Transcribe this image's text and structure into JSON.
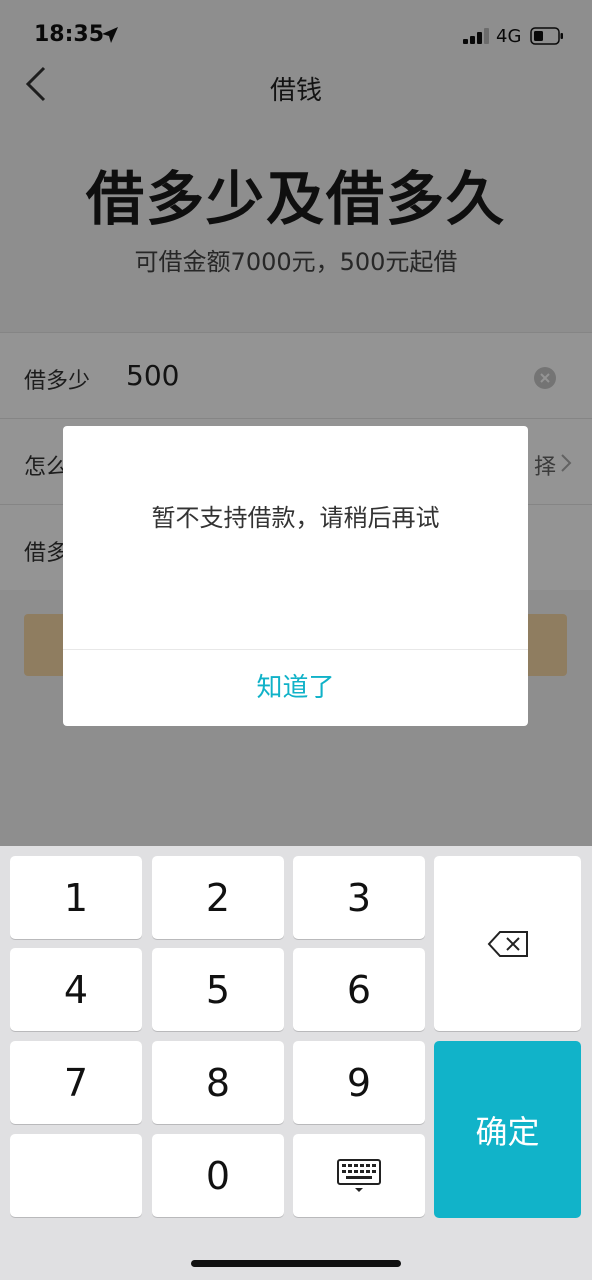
{
  "status_bar": {
    "time": "18:35",
    "network": "4G"
  },
  "nav": {
    "title": "借钱"
  },
  "hero": {
    "title": "借多少及借多久",
    "subtitle": "可借金额7000元，500元起借"
  },
  "form": {
    "amount_label": "借多少",
    "amount_value": "500",
    "row2_label": "怎么",
    "row2_value": "择",
    "row3_label": "借多"
  },
  "dialog": {
    "message": "暂不支持借款，请稍后再试",
    "button": "知道了"
  },
  "keypad": {
    "keys": [
      "1",
      "2",
      "3",
      "4",
      "5",
      "6",
      "7",
      "8",
      "9",
      "",
      "0"
    ],
    "confirm": "确定"
  },
  "colors": {
    "accent": "#11b3c9",
    "submit_disabled": "#f7d7a6"
  },
  "icons": [
    "location-arrow-icon",
    "signal-icon",
    "battery-icon",
    "back-icon",
    "clear-icon",
    "chevron-right-icon",
    "delete-key-icon",
    "keyboard-hide-icon"
  ]
}
